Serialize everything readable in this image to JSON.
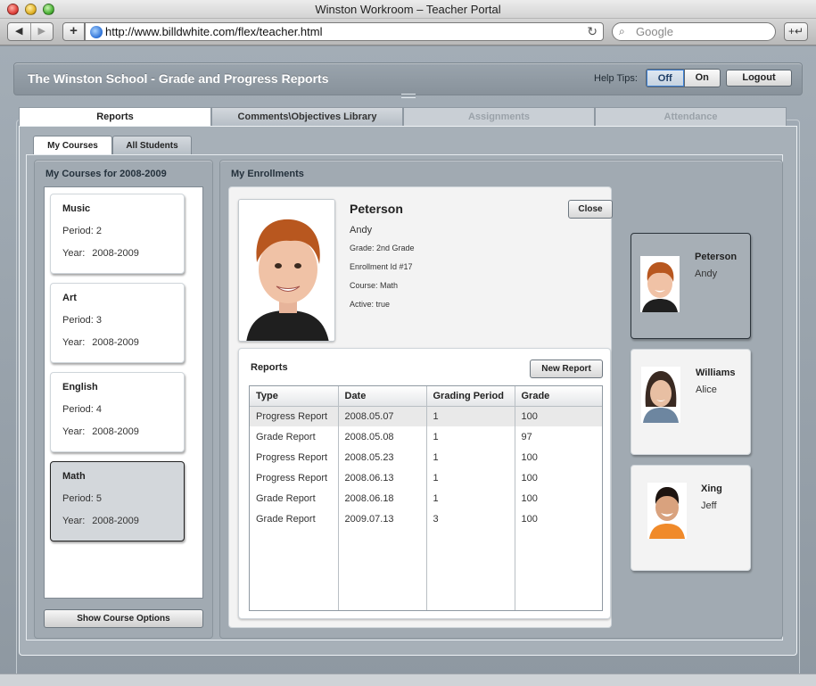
{
  "browser": {
    "window_title": "Winston Workroom – Teacher Portal",
    "back_icon": "◀",
    "forward_icon": "▶",
    "add_icon": "+",
    "url": "http://www.billdwhite.com/flex/teacher.html",
    "reload_icon": "↻",
    "search_placeholder": "Google",
    "search_icon": "⌕",
    "bookmark_icon": "+↵"
  },
  "header": {
    "title": "The Winston School - Grade and Progress Reports",
    "help_tips_label": "Help Tips:",
    "help_off": "Off",
    "help_on": "On",
    "help_selected": "Off",
    "logout": "Logout"
  },
  "main_tabs": [
    {
      "label": "Reports",
      "state": "active"
    },
    {
      "label": "Comments\\Objectives Library",
      "state": "normal"
    },
    {
      "label": "Assignments",
      "state": "disabled"
    },
    {
      "label": "Attendance",
      "state": "disabled"
    }
  ],
  "sub_tabs": [
    {
      "label": "My Courses",
      "state": "active"
    },
    {
      "label": "All Students",
      "state": "normal"
    }
  ],
  "courses_panel": {
    "title": "My Courses for 2008-2009",
    "period_label": "Period:",
    "year_label": "Year:",
    "courses": [
      {
        "name": "Music",
        "period": "2",
        "year": "2008-2009",
        "selected": false
      },
      {
        "name": "Art",
        "period": "3",
        "year": "2008-2009",
        "selected": false
      },
      {
        "name": "English",
        "period": "4",
        "year": "2008-2009",
        "selected": false
      },
      {
        "name": "Math",
        "period": "5",
        "year": "2008-2009",
        "selected": true
      }
    ],
    "show_options_button": "Show Course Options"
  },
  "enrollments": {
    "title": "My Enrollments",
    "detail": {
      "last_name": "Peterson",
      "first_name": "Andy",
      "grade": "Grade: 2nd Grade",
      "enrollment_id": "Enrollment Id #17",
      "course": "Course: Math",
      "active": "Active: true",
      "close_button": "Close"
    },
    "reports": {
      "title": "Reports",
      "new_report_button": "New Report",
      "columns": [
        "Type",
        "Date",
        "Grading Period",
        "Grade"
      ],
      "rows": [
        [
          "Progress Report",
          "2008.05.07",
          "1",
          "100"
        ],
        [
          "Grade Report",
          "2008.05.08",
          "1",
          "97"
        ],
        [
          "Progress Report",
          "2008.05.23",
          "1",
          "100"
        ],
        [
          "Progress Report",
          "2008.06.13",
          "1",
          "100"
        ],
        [
          "Grade Report",
          "2008.06.18",
          "1",
          "100"
        ],
        [
          "Grade Report",
          "2009.07.13",
          "3",
          "100"
        ]
      ],
      "highlighted_row": 0
    },
    "students": [
      {
        "last_name": "Peterson",
        "first_name": "Andy",
        "selected": true
      },
      {
        "last_name": "Williams",
        "first_name": "Alice",
        "selected": false
      },
      {
        "last_name": "Xing",
        "first_name": "Jeff",
        "selected": false
      }
    ]
  }
}
